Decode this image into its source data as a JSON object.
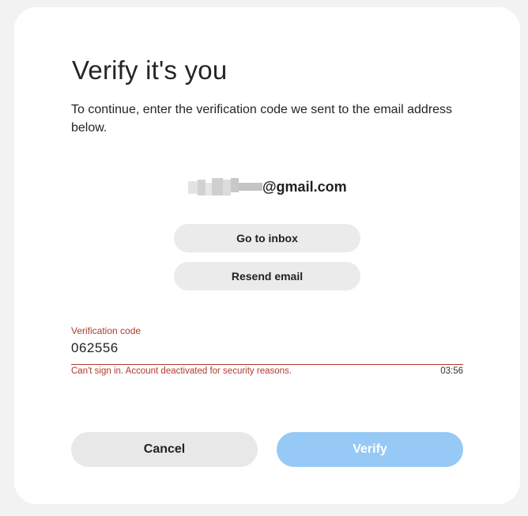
{
  "dialog": {
    "title": "Verify it's you",
    "description": "To continue, enter the verification code we sent to the email address below.",
    "email": {
      "redacted": true,
      "domain": "@gmail.com"
    }
  },
  "buttons": {
    "go_to_inbox": "Go to inbox",
    "resend_email": "Resend email",
    "cancel": "Cancel",
    "verify": "Verify"
  },
  "verification_field": {
    "label": "Verification code",
    "value": "062556",
    "error": "Can't sign in. Account deactivated for security reasons.",
    "timer": "03:56"
  },
  "colors": {
    "error": "#b03a2e",
    "verify_button_disabled": "#96c9f6",
    "secondary_button": "#ebebeb",
    "page_background": "#f2f2f2"
  }
}
